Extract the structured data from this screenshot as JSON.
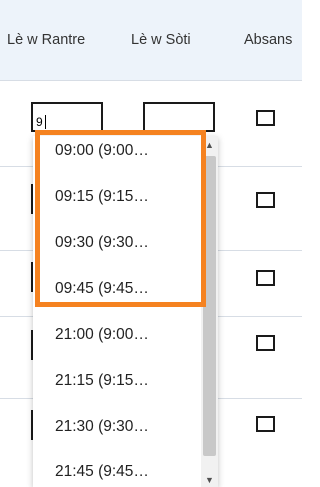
{
  "header": {
    "col_in": "Lè w Rantre",
    "col_out": "Lè w Sòti",
    "col_absent": "Absans"
  },
  "row1": {
    "time_in_value": "9"
  },
  "dropdown": {
    "options": [
      "09:00 (9:00…",
      "09:15 (9:15…",
      "09:30 (9:30…",
      "09:45 (9:45…",
      "21:00 (9:00…",
      "21:15 (9:15…",
      "21:30 (9:30…",
      "21:45 (9:45…"
    ],
    "scroll_up_icon": "▲",
    "scroll_down_icon": "▼"
  },
  "colors": {
    "header_bg": "#edf3fa",
    "highlight": "#f58220"
  }
}
